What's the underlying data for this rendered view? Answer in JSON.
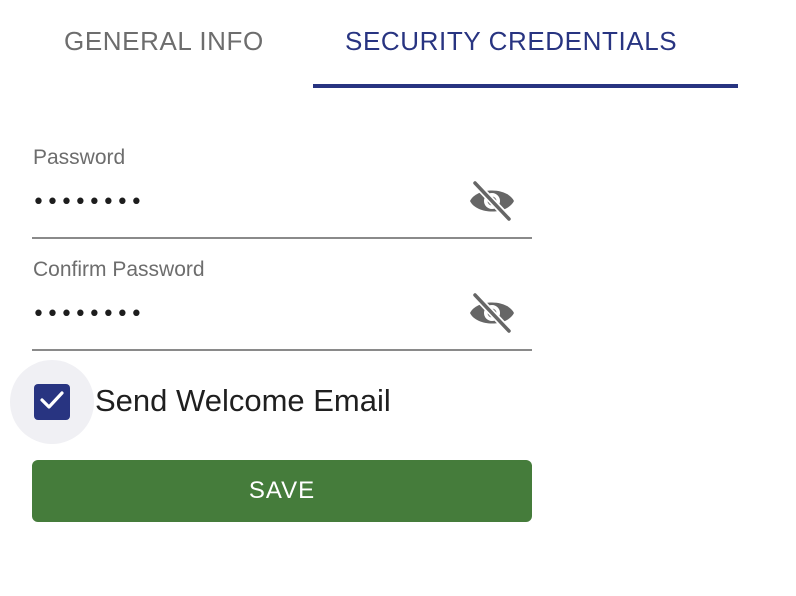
{
  "tabs": [
    {
      "label": "GENERAL INFO",
      "active": false
    },
    {
      "label": "SECURITY CREDENTIALS",
      "active": true
    }
  ],
  "colors": {
    "accent": "#283481",
    "save_button": "#457c3b",
    "inactive_text": "#6d6d6d"
  },
  "form": {
    "password": {
      "label": "Password",
      "value": "••••••••",
      "visibility_icon": "eye-off-icon"
    },
    "confirm_password": {
      "label": "Confirm Password",
      "value": "••••••••",
      "visibility_icon": "eye-off-icon"
    },
    "send_welcome_email": {
      "label": "Send Welcome Email",
      "checked": true,
      "icon": "checkmark-icon"
    },
    "save_label": "SAVE"
  }
}
